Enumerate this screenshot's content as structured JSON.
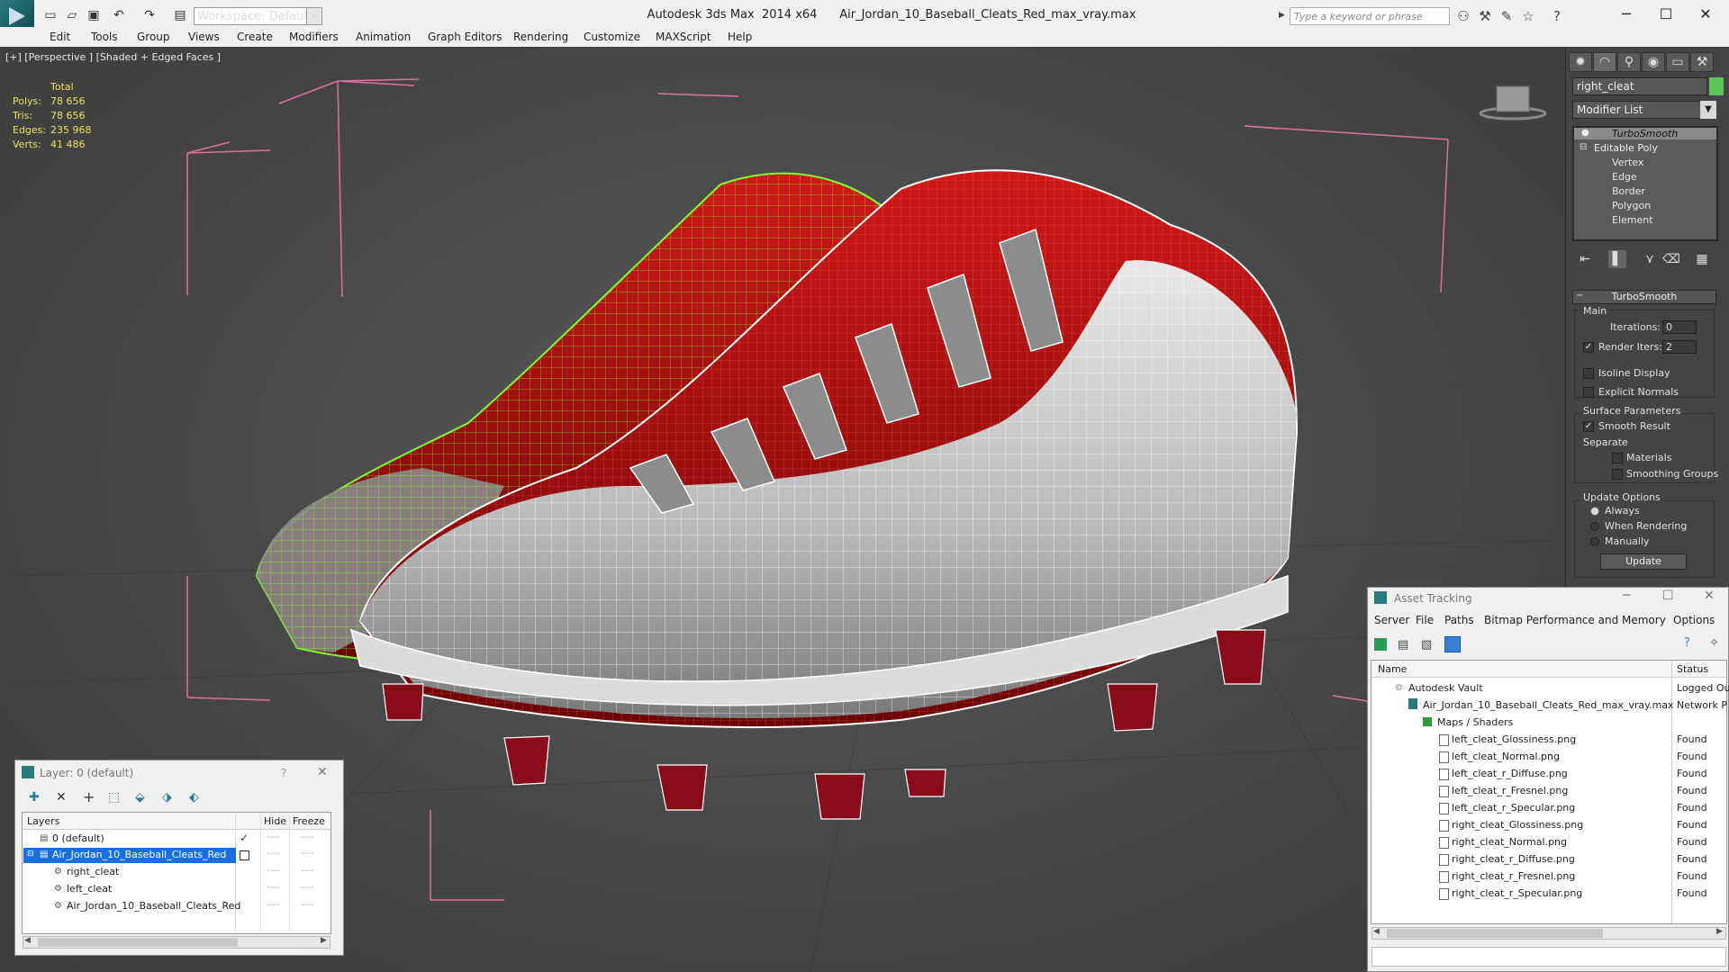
{
  "titlebar": {
    "app": "Autodesk 3ds Max  2014 x64",
    "file": "Air_Jordan_10_Baseball_Cleats_Red_max_vray.max",
    "workspace": "Workspace: Default",
    "search_placeholder": "Type a keyword or phrase"
  },
  "menu": [
    "Edit",
    "Tools",
    "Group",
    "Views",
    "Create",
    "Modifiers",
    "Animation",
    "Graph Editors",
    "Rendering",
    "Customize",
    "MAXScript",
    "Help"
  ],
  "viewport": {
    "label": "[+] [Perspective ] [Shaded + Edged Faces ]",
    "stats": {
      "header": "Total",
      "rows": [
        {
          "label": "Polys:",
          "value": "78 656"
        },
        {
          "label": "Tris:",
          "value": "78 656"
        },
        {
          "label": "Edges:",
          "value": "235 968"
        },
        {
          "label": "Verts:",
          "value": "41 486"
        }
      ]
    }
  },
  "command_panel": {
    "object_name": "right_cleat",
    "object_color": "#5ec35a",
    "modifier_list": "Modifier List",
    "stack": {
      "top": "TurboSmooth",
      "base": "Editable Poly",
      "subs": [
        "Vertex",
        "Edge",
        "Border",
        "Polygon",
        "Element"
      ]
    },
    "rollout": {
      "title": "TurboSmooth",
      "main": "Main",
      "iterations_label": "Iterations:",
      "iterations_value": "0",
      "render_iters_label": "Render Iters:",
      "render_iters_value": "2",
      "isoline": "Isoline Display",
      "explicit_normals": "Explicit Normals",
      "surface_params": "Surface Parameters",
      "smooth_result": "Smooth Result",
      "separate": "Separate",
      "materials": "Materials",
      "smoothing_groups": "Smoothing Groups",
      "update_options": "Update Options",
      "always": "Always",
      "when_rendering": "When Rendering",
      "manually": "Manually",
      "update": "Update"
    }
  },
  "asset_tracking": {
    "title": "Asset Tracking",
    "menu": [
      "Server",
      "File",
      "Paths",
      "Bitmap Performance and Memory",
      "Options"
    ],
    "col_name": "Name",
    "col_status": "Status",
    "rows": [
      {
        "name": "Autodesk Vault",
        "status": "Logged Ou"
      },
      {
        "name": "Air_Jordan_10_Baseball_Cleats_Red_max_vray.max",
        "status": "Network P"
      },
      {
        "name": "Maps / Shaders",
        "status": ""
      },
      {
        "name": "left_cleat_Glossiness.png",
        "status": "Found"
      },
      {
        "name": "left_cleat_Normal.png",
        "status": "Found"
      },
      {
        "name": "left_cleat_r_Diffuse.png",
        "status": "Found"
      },
      {
        "name": "left_cleat_r_Fresnel.png",
        "status": "Found"
      },
      {
        "name": "left_cleat_r_Specular.png",
        "status": "Found"
      },
      {
        "name": "right_cleat_Glossiness.png",
        "status": "Found"
      },
      {
        "name": "right_cleat_Normal.png",
        "status": "Found"
      },
      {
        "name": "right_cleat_r_Diffuse.png",
        "status": "Found"
      },
      {
        "name": "right_cleat_r_Fresnel.png",
        "status": "Found"
      },
      {
        "name": "right_cleat_r_Specular.png",
        "status": "Found"
      }
    ]
  },
  "layer_window": {
    "title": "Layer: 0 (default)",
    "help": "?",
    "col_layers": "Layers",
    "col_hide": "Hide",
    "col_freeze": "Freeze",
    "rows": [
      {
        "name": "0 (default)"
      },
      {
        "name": "Air_Jordan_10_Baseball_Cleats_Red"
      },
      {
        "name": "right_cleat"
      },
      {
        "name": "left_cleat"
      },
      {
        "name": "Air_Jordan_10_Baseball_Cleats_Red"
      }
    ]
  }
}
